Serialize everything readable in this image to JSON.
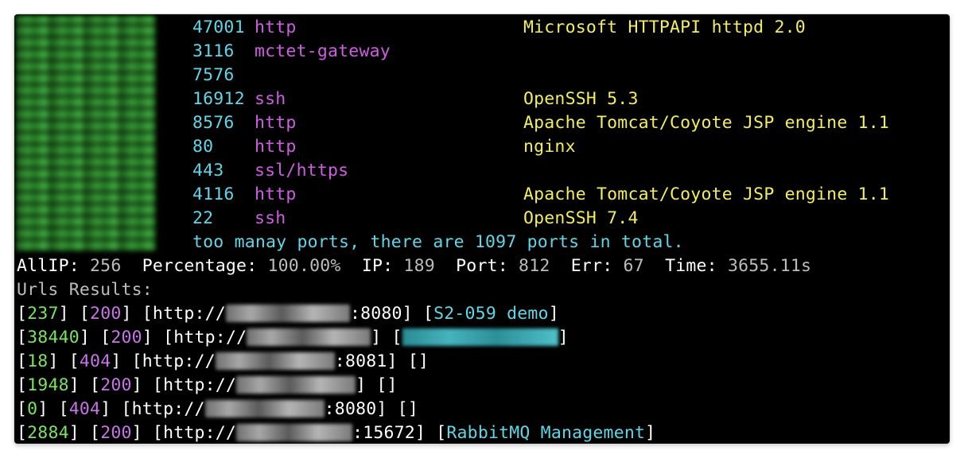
{
  "ports": [
    {
      "port": "47001",
      "service": "http",
      "version": "Microsoft HTTPAPI httpd 2.0"
    },
    {
      "port": "3116",
      "service": "mctet-gateway",
      "version": ""
    },
    {
      "port": "7576",
      "service": "",
      "version": ""
    },
    {
      "port": "16912",
      "service": "ssh",
      "version": "OpenSSH 5.3"
    },
    {
      "port": "8576",
      "service": "http",
      "version": "Apache Tomcat/Coyote JSP engine 1.1"
    },
    {
      "port": "80",
      "service": "http",
      "version": "nginx"
    },
    {
      "port": "443",
      "service": "ssl/https",
      "version": ""
    },
    {
      "port": "4116",
      "service": "http",
      "version": "Apache Tomcat/Coyote JSP engine 1.1"
    },
    {
      "port": "22",
      "service": "ssh",
      "version": "OpenSSH 7.4"
    }
  ],
  "too_many_note": "too manay ports, there are 1097 ports in total.",
  "summary": {
    "allip_label": "AllIP:",
    "allip_value": "256",
    "percentage_label": "Percentage:",
    "percentage_value": "100.00%",
    "ip_label": "IP:",
    "ip_value": "189",
    "port_label": "Port:",
    "port_value": "812",
    "err_label": "Err:",
    "err_value": "67",
    "time_label": "Time:",
    "time_value": "3655.11s"
  },
  "urls_header": "Urls Results:",
  "urls": [
    {
      "size": "237",
      "status": "200",
      "prefix": "[http://",
      "suffix": ":8080]",
      "title": "S2-059 demo",
      "title_redacted": false
    },
    {
      "size": "38440",
      "status": "200",
      "prefix": "[http://",
      "suffix": "]",
      "title": "",
      "title_redacted": true
    },
    {
      "size": "18",
      "status": "404",
      "prefix": "[http://",
      "suffix": ":8081]",
      "title": "",
      "title_redacted": false
    },
    {
      "size": "1948",
      "status": "200",
      "prefix": "[http://",
      "suffix": "]",
      "title": "",
      "title_redacted": false
    },
    {
      "size": "0",
      "status": "404",
      "prefix": "[http://",
      "suffix": ":8080]",
      "title": "",
      "title_redacted": false
    },
    {
      "size": "2884",
      "status": "200",
      "prefix": "[http://",
      "suffix": ":15672]",
      "title": "RabbitMQ Management",
      "title_redacted": false
    }
  ],
  "colors": {
    "background": "#000000",
    "port": "#5fd7e8",
    "service": "#d05ce3",
    "version": "#f4ee5c",
    "size": "#7be361",
    "status": "#c874e8",
    "title": "#5fd7e8"
  }
}
